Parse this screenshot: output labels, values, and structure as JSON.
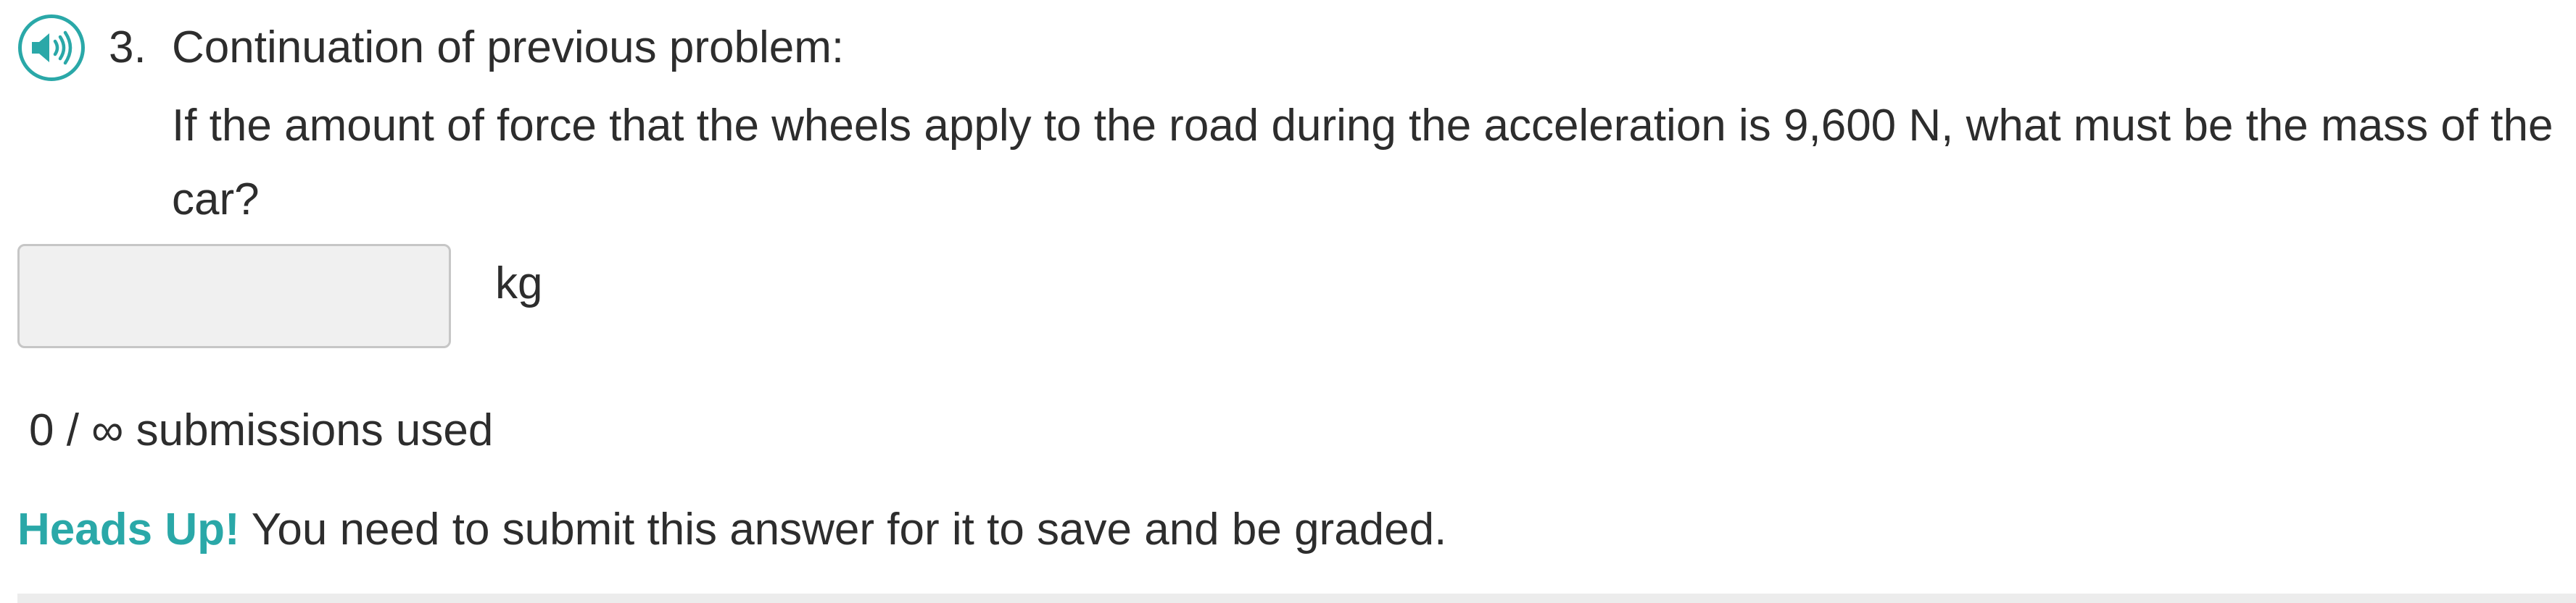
{
  "question": {
    "number": "3.",
    "title": "Continuation of previous problem:",
    "body": "If the amount of force that the wheels apply to the road during the acceleration is 9,600 N, what must be the mass of the car?",
    "audio_icon": "speaker-icon"
  },
  "answer": {
    "value": "",
    "unit": "kg"
  },
  "submissions": {
    "text": "0 / ∞ submissions used"
  },
  "notice": {
    "highlight": "Heads Up!",
    "message": " You need to submit this answer for it to save and be graded."
  },
  "colors": {
    "accent": "#2aa8a8",
    "text": "#2d2d2d",
    "input_bg": "#f0f0f0",
    "input_border": "#c6c6c6"
  }
}
